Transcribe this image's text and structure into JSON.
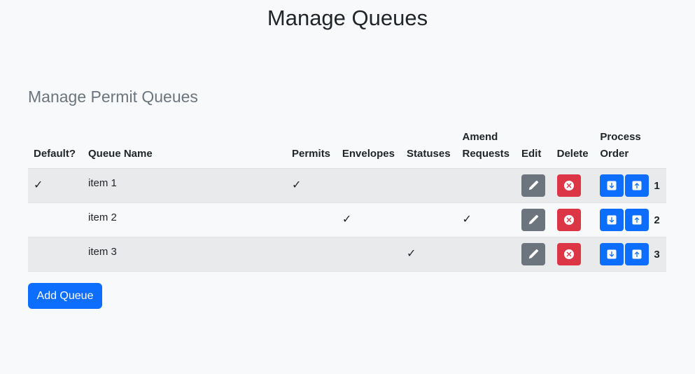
{
  "page": {
    "title": "Manage Queues"
  },
  "section": {
    "title": "Manage Permit Queues"
  },
  "table": {
    "headers": {
      "default": "Default?",
      "queue_name": "Queue Name",
      "permits": "Permits",
      "envelopes": "Envelopes",
      "statuses": "Statuses",
      "amend_line1": "Amend",
      "amend_line2": "Requests",
      "edit": "Edit",
      "delete": "Delete",
      "process_line1": "Process",
      "process_line2": "Order"
    },
    "check_mark": "✓",
    "rows": [
      {
        "name": "item 1",
        "default": "✓",
        "permits": "✓",
        "envelopes": "",
        "statuses": "",
        "amend": "",
        "order": "1"
      },
      {
        "name": "item 2",
        "default": "",
        "permits": "",
        "envelopes": "✓",
        "statuses": "",
        "amend": "✓",
        "order": "2"
      },
      {
        "name": "item 3",
        "default": "",
        "permits": "",
        "envelopes": "",
        "statuses": "✓",
        "amend": "",
        "order": "3"
      }
    ]
  },
  "actions": {
    "add_label": "Add Queue"
  },
  "icons": {
    "edit": "pencil-icon",
    "delete": "x-circle-icon",
    "move_down": "arrow-down-icon",
    "move_up": "arrow-up-icon"
  },
  "colors": {
    "primary": "#0d6efd",
    "secondary": "#6c757d",
    "danger": "#dc3545"
  }
}
